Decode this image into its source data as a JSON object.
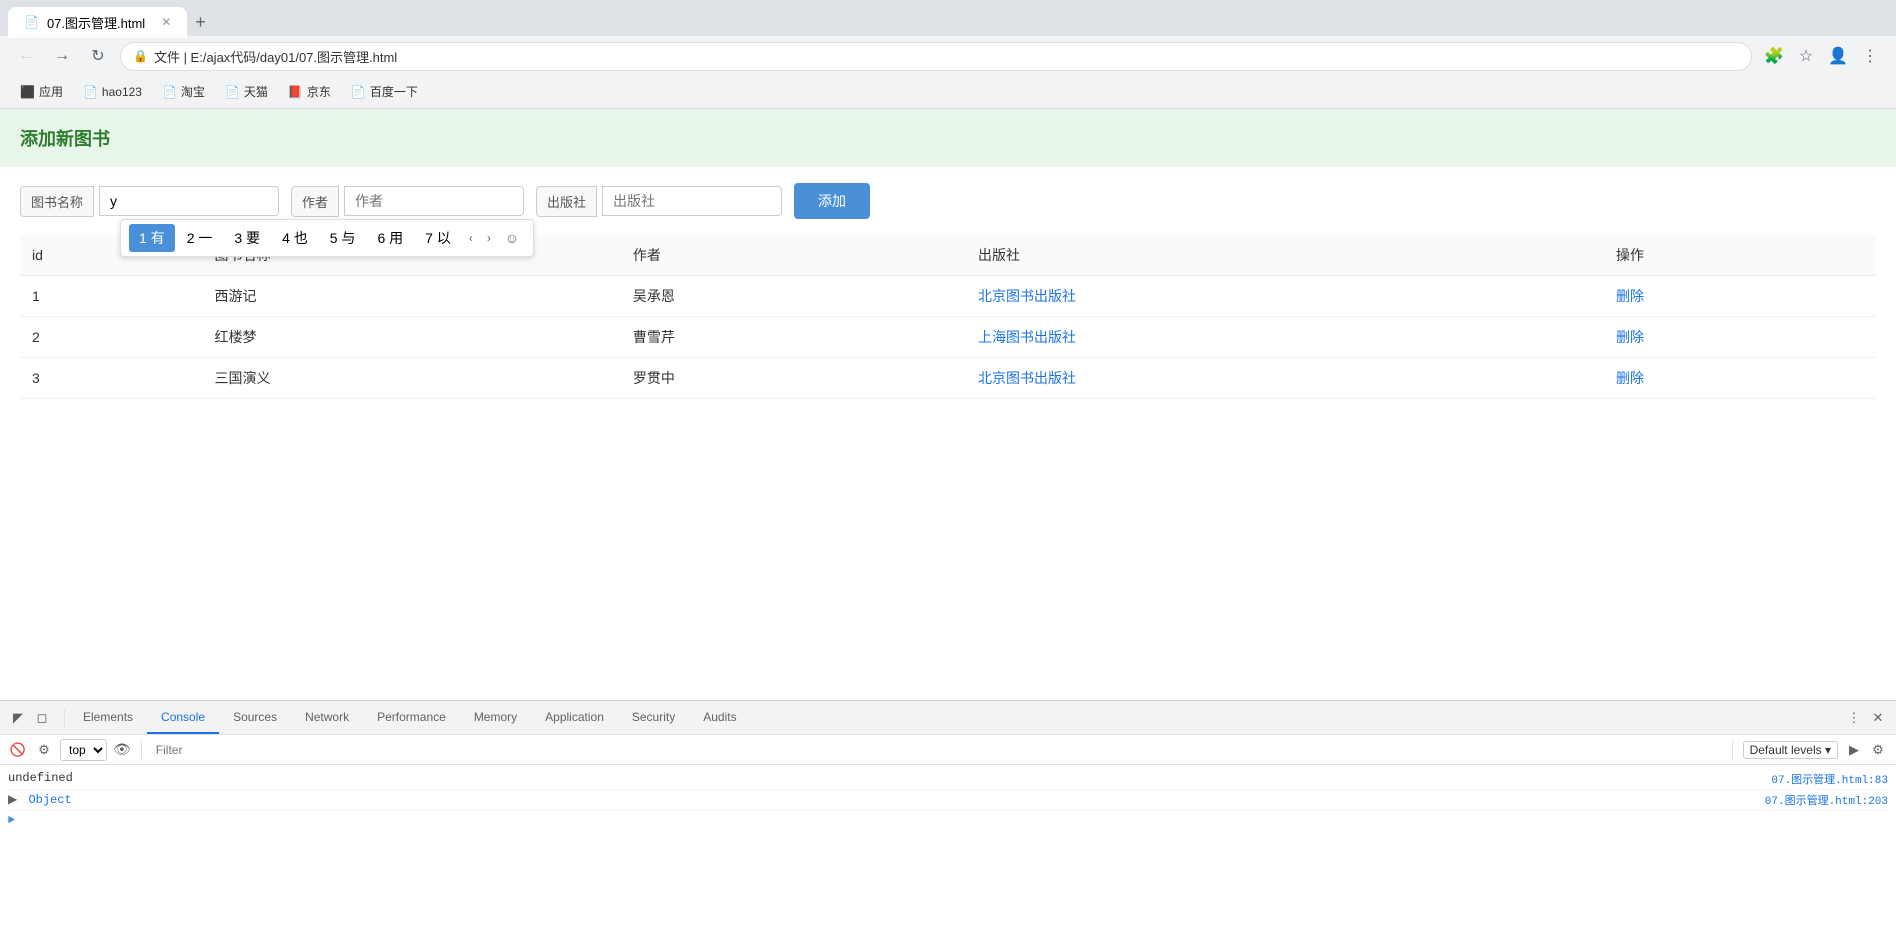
{
  "browser": {
    "tab_title": "07.图示管理.html",
    "tab_icon": "📄",
    "address": "文件  |  E:/ajax代码/day01/07.图示管理.html",
    "bookmarks": [
      {
        "label": "应用",
        "icon": "⬛"
      },
      {
        "label": "hao123",
        "icon": "📄"
      },
      {
        "label": "淘宝",
        "icon": "📄"
      },
      {
        "label": "天猫",
        "icon": "📄"
      },
      {
        "label": "京东",
        "icon": "📕"
      },
      {
        "label": "百度一下",
        "icon": "📄"
      }
    ]
  },
  "page": {
    "header_title": "添加新图书",
    "form": {
      "book_name_label": "图书名称",
      "book_name_value": "y",
      "author_label": "作者",
      "author_placeholder": "作者",
      "publisher_label": "出版社",
      "publisher_placeholder": "出版社",
      "add_button": "添加"
    },
    "ime": {
      "candidates": [
        {
          "index": "1",
          "text": "有",
          "selected": true
        },
        {
          "index": "2",
          "text": "一"
        },
        {
          "index": "3",
          "text": "要"
        },
        {
          "index": "4",
          "text": "也"
        },
        {
          "index": "5",
          "text": "与"
        },
        {
          "index": "6",
          "text": "用"
        },
        {
          "index": "7",
          "text": "以"
        }
      ]
    },
    "table": {
      "headers": [
        "id",
        "图书名称",
        "作者",
        "出版社",
        "操作"
      ],
      "rows": [
        {
          "id": "1",
          "name": "西游记",
          "author": "吴承恩",
          "publisher": "北京图书出版社",
          "action": "删除"
        },
        {
          "id": "2",
          "name": "红楼梦",
          "author": "曹雪芹",
          "publisher": "上海图书出版社",
          "action": "删除"
        },
        {
          "id": "3",
          "name": "三国演义",
          "author": "罗贯中",
          "publisher": "北京图书出版社",
          "action": "删除"
        }
      ]
    }
  },
  "devtools": {
    "tabs": [
      {
        "label": "Elements",
        "active": false
      },
      {
        "label": "Console",
        "active": true
      },
      {
        "label": "Sources",
        "active": false
      },
      {
        "label": "Network",
        "active": false
      },
      {
        "label": "Performance",
        "active": false
      },
      {
        "label": "Memory",
        "active": false
      },
      {
        "label": "Application",
        "active": false
      },
      {
        "label": "Security",
        "active": false
      },
      {
        "label": "Audits",
        "active": false
      }
    ],
    "toolbar": {
      "top_label": "top",
      "filter_placeholder": "Filter",
      "default_levels": "Default levels ▾"
    },
    "console_lines": [
      {
        "text": "undefined",
        "link": "07.图示管理.html:83",
        "type": "text"
      },
      {
        "text": "▶ Object",
        "link": "07.图示管理.html:203",
        "type": "object"
      }
    ],
    "prompt": ">"
  }
}
